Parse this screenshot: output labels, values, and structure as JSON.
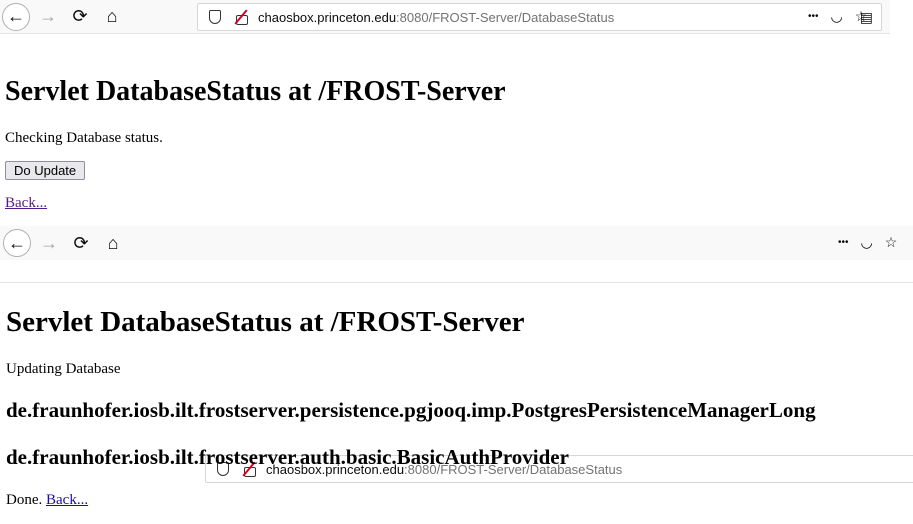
{
  "browser1": {
    "url_host": "chaosbox.princeton.edu",
    "url_rest": ":8080/FROST-Server/DatabaseStatus"
  },
  "page1": {
    "title": "Servlet DatabaseStatus at /FROST-Server",
    "status": "Checking Database status.",
    "update_button": "Do Update",
    "back_link": "Back..."
  },
  "browser2": {
    "url_host": "chaosbox.princeton.edu",
    "url_rest": ":8080/FROST-Server/DatabaseStatus"
  },
  "page2": {
    "title": "Servlet DatabaseStatus at /FROST-Server",
    "status": "Updating Database",
    "class1": "de.fraunhofer.iosb.ilt.frostserver.persistence.pgjooq.imp.PostgresPersistenceManagerLong",
    "class2": "de.fraunhofer.iosb.ilt.frostserver.auth.basic.BasicAuthProvider",
    "done": "Done.",
    "back_link": "Back..."
  },
  "icons": {
    "back": "←",
    "forward": "→",
    "reload": "⟳",
    "home": "⌂",
    "reader": "▤",
    "more": "•••",
    "pocket": "◡",
    "star": "☆"
  }
}
